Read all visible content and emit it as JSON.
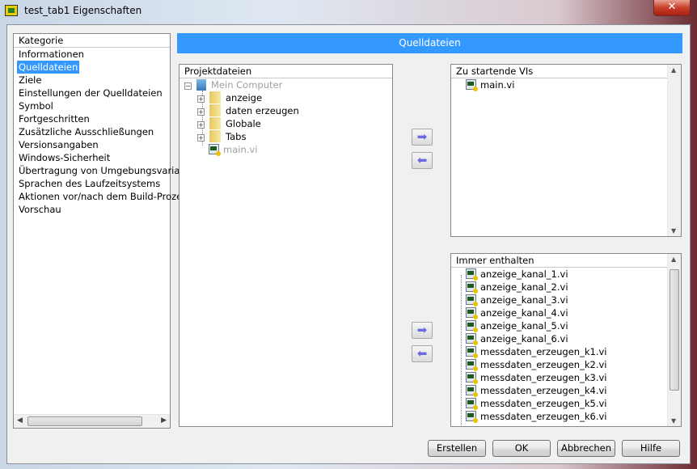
{
  "window": {
    "title": "test_tab1 Eigenschaften",
    "close": "✕"
  },
  "sidebar": {
    "header": "Kategorie",
    "selected": 1,
    "items": [
      "Informationen",
      "Quelldateien",
      "Ziele",
      "Einstellungen der Quelldateien",
      "Symbol",
      "Fortgeschritten",
      "Zusätzliche Ausschließungen",
      "Versionsangaben",
      "Windows-Sicherheit",
      "Übertragung von Umgebungsvariab",
      "Sprachen des Laufzeitsystems",
      "Aktionen vor/nach dem Build-Proze",
      "Vorschau"
    ]
  },
  "main": {
    "title": "Quelldateien",
    "project": {
      "header": "Projektdateien",
      "root": "Mein Computer",
      "folders": [
        "anzeige",
        "daten erzeugen",
        "Globale",
        "Tabs"
      ],
      "file": "main.vi"
    },
    "startup": {
      "header": "Zu startende VIs",
      "items": [
        "main.vi"
      ]
    },
    "always": {
      "header": "Immer enthalten",
      "items": [
        "anzeige_kanal_1.vi",
        "anzeige_kanal_2.vi",
        "anzeige_kanal_3.vi",
        "anzeige_kanal_4.vi",
        "anzeige_kanal_5.vi",
        "anzeige_kanal_6.vi",
        "messdaten_erzeugen_k1.vi",
        "messdaten_erzeugen_k2.vi",
        "messdaten_erzeugen_k3.vi",
        "messdaten_erzeugen_k4.vi",
        "messdaten_erzeugen_k5.vi",
        "messdaten_erzeugen_k6.vi"
      ]
    },
    "arrows": {
      "add": "➡",
      "remove": "⬅"
    }
  },
  "buttons": {
    "build": "Erstellen",
    "ok": "OK",
    "cancel": "Abbrechen",
    "help": "Hilfe"
  },
  "colors": {
    "accent": "#3399ff"
  }
}
